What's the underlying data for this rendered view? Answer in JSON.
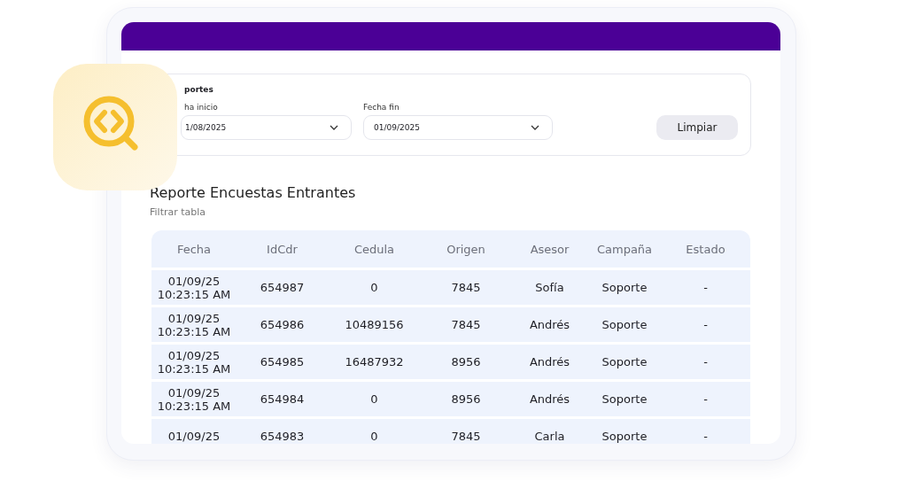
{
  "filters": {
    "title": "portes",
    "fields": [
      {
        "label": "ha inicio",
        "value": "1/08/2025"
      },
      {
        "label": "Fecha fin",
        "value": "01/09/2025"
      }
    ],
    "button": "Limpiar"
  },
  "report": {
    "title": "Reporte Encuestas Entrantes",
    "filter_label": "Filtrar tabla"
  },
  "table": {
    "columns": [
      "Fecha",
      "IdCdr",
      "Cedula",
      "Origen",
      "Asesor",
      "Campaña",
      "Estado"
    ],
    "rows": [
      {
        "cells": [
          [
            "01/09/25",
            "10:23:15 AM"
          ],
          "654987",
          "0",
          "7845",
          "Sofía",
          "Soporte",
          "-"
        ]
      },
      {
        "cells": [
          [
            "01/09/25",
            "10:23:15 AM"
          ],
          "654986",
          "10489156",
          "7845",
          "Andrés",
          "Soporte",
          "-"
        ]
      },
      {
        "cells": [
          [
            "01/09/25",
            "10:23:15 AM"
          ],
          "654985",
          "16487932",
          "8956",
          "Andrés",
          "Soporte",
          "-"
        ]
      },
      {
        "cells": [
          [
            "01/09/25",
            "10:23:15 AM"
          ],
          "654984",
          "0",
          "8956",
          "Andrés",
          "Soporte",
          "-"
        ]
      },
      {
        "cells": [
          [
            "01/09/25"
          ],
          "654983",
          "0",
          "7845",
          "Carla",
          "Soporte",
          "-"
        ]
      }
    ]
  }
}
